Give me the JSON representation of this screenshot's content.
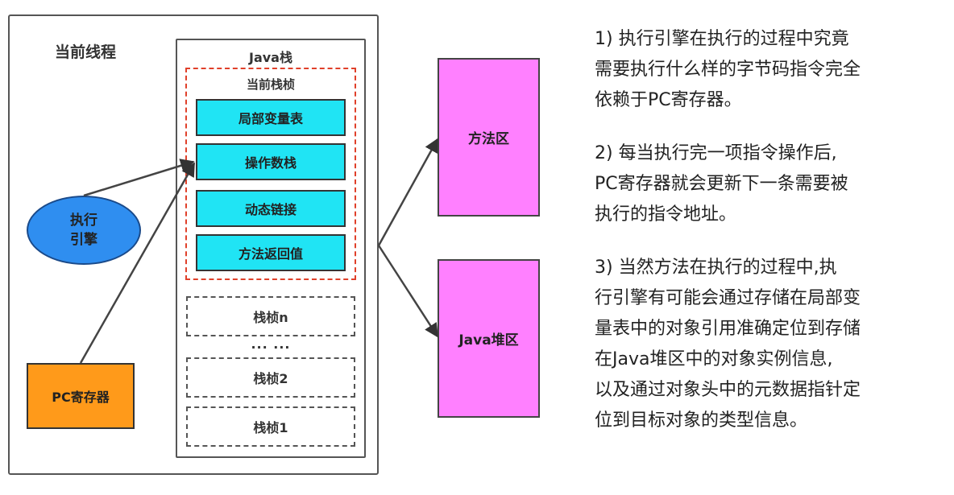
{
  "thread": {
    "label": "当前线程"
  },
  "java_stack": {
    "label": "Java栈"
  },
  "current_frame": {
    "label": "当前栈桢",
    "items": [
      "局部变量表",
      "操作数栈",
      "动态链接",
      "方法返回值"
    ]
  },
  "other_frames": [
    "栈桢n",
    "栈桢2",
    "栈桢1"
  ],
  "ellipsis": "... ...",
  "engine": {
    "line1": "执行",
    "line2": "引擎"
  },
  "pc_register": {
    "label": "PC寄存器"
  },
  "method_area": {
    "label": "方法区"
  },
  "heap": {
    "label": "Java堆区"
  },
  "notes": [
    {
      "lines": [
        "1) 执行引擎在执行的过程中究竟",
        "需要执行什么样的字节码指令完全",
        "依赖于PC寄存器。"
      ]
    },
    {
      "lines": [
        "2) 每当执行完一项指令操作后,",
        "PC寄存器就会更新下一条需要被",
        "执行的指令地址。"
      ]
    },
    {
      "lines": [
        "3) 当然方法在执行的过程中,执",
        "行引擎有可能会通过存储在局部变",
        "量表中的对象引用准确定位到存储",
        "在Java堆区中的对象实例信息,",
        "以及通过对象头中的元数据指针定",
        "位到目标对象的类型信息。"
      ]
    }
  ],
  "colors": {
    "frame_items": "#20e4f4",
    "engine": "#2f8ef0",
    "pc_register": "#ff9a1a",
    "memory_areas": "#ff80ff",
    "frame_border": "#e0402a"
  }
}
